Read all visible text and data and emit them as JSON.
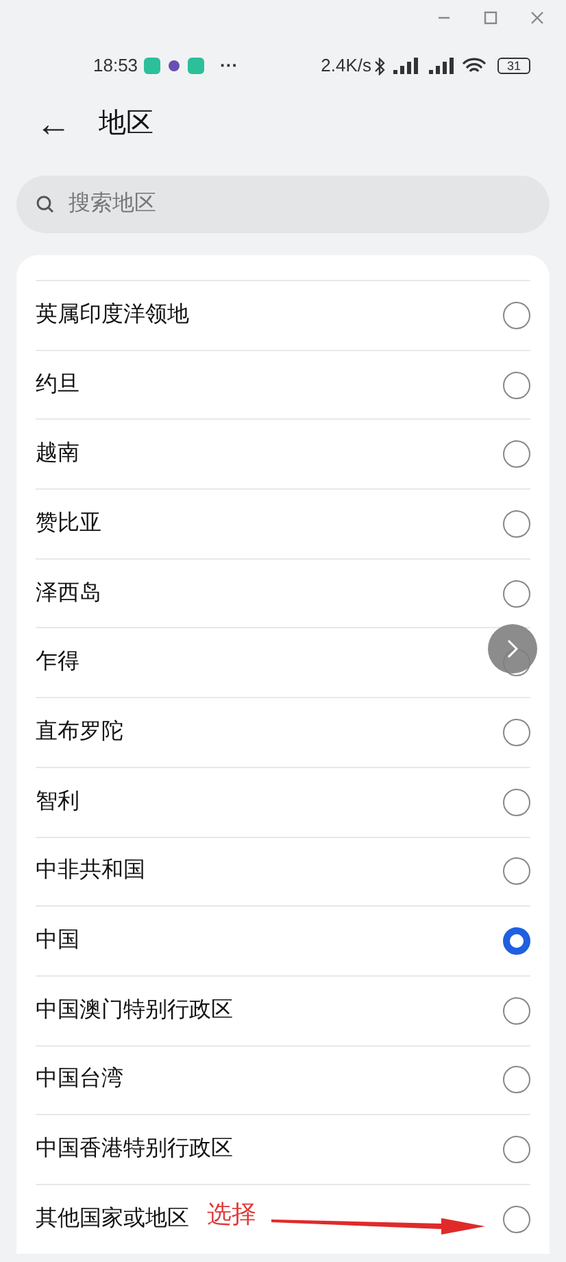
{
  "status_bar": {
    "time": "18:53",
    "more": "···",
    "speed": "2.4K/s",
    "battery": "31"
  },
  "header": {
    "back": "←",
    "title": "地区"
  },
  "search": {
    "placeholder": "搜索地区"
  },
  "regions": [
    {
      "name": "英属印度洋领地",
      "selected": false
    },
    {
      "name": "约旦",
      "selected": false
    },
    {
      "name": "越南",
      "selected": false
    },
    {
      "name": "赞比亚",
      "selected": false
    },
    {
      "name": "泽西岛",
      "selected": false
    },
    {
      "name": "乍得",
      "selected": false
    },
    {
      "name": "直布罗陀",
      "selected": false
    },
    {
      "name": "智利",
      "selected": false
    },
    {
      "name": "中非共和国",
      "selected": false
    },
    {
      "name": "中国",
      "selected": true
    },
    {
      "name": "中国澳门特别行政区",
      "selected": false
    },
    {
      "name": "中国台湾",
      "selected": false
    },
    {
      "name": "中国香港特别行政区",
      "selected": false
    },
    {
      "name": "其他国家或地区",
      "selected": false
    }
  ],
  "annotation": {
    "text": "选择"
  }
}
